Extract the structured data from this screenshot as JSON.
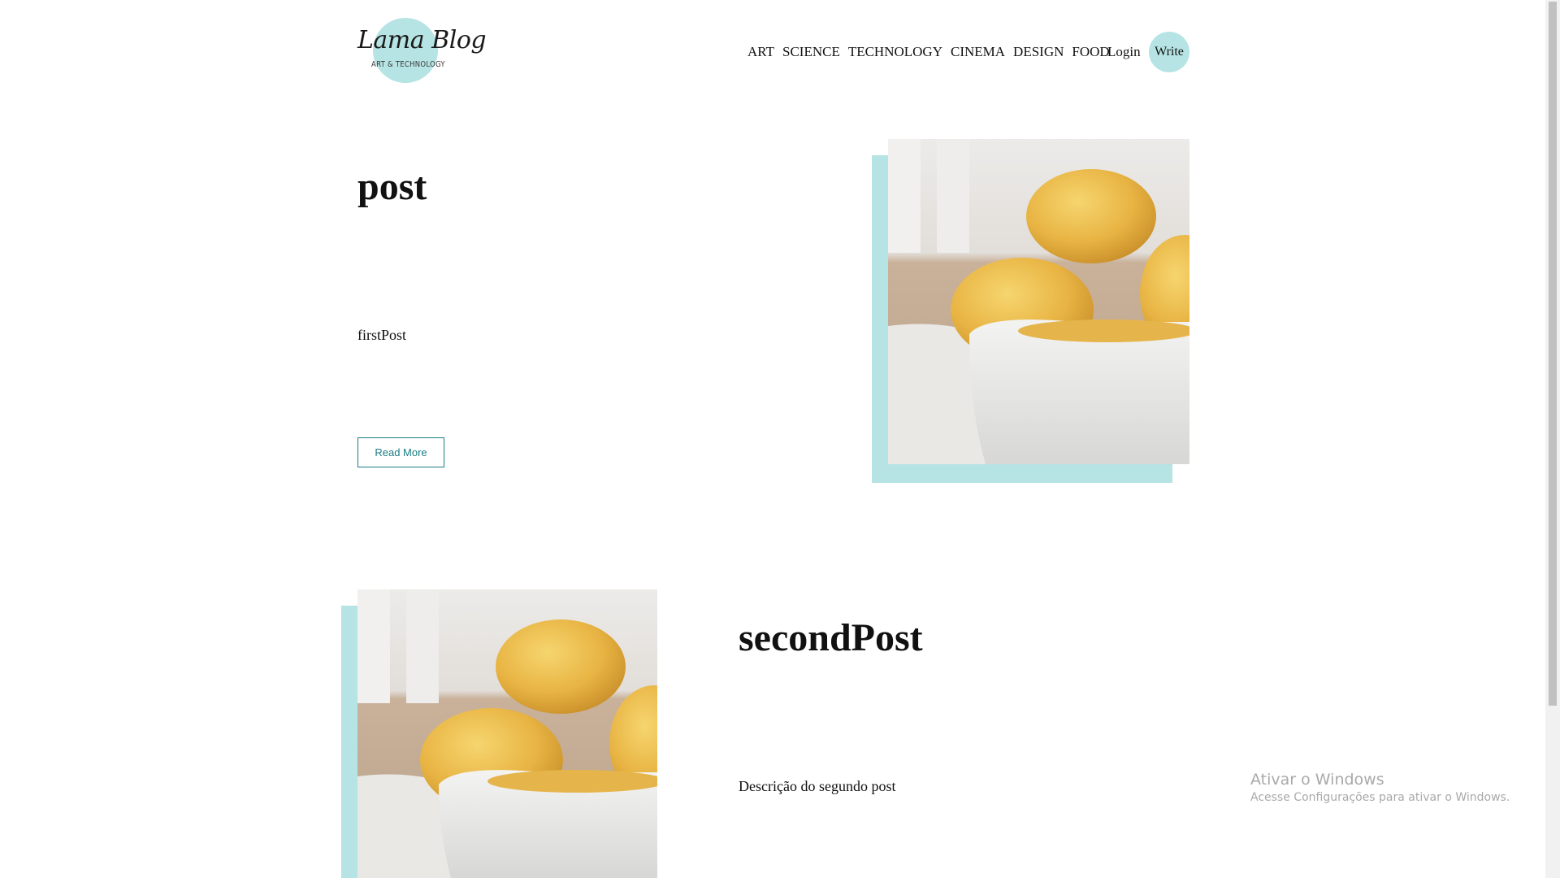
{
  "logo": {
    "title": "Lama Blog",
    "subtitle": "ART & TECHNOLOGY",
    "accent_color": "#b6e3e3"
  },
  "nav": {
    "items": [
      "ART",
      "SCIENCE",
      "TECHNOLOGY",
      "CINEMA",
      "DESIGN",
      "FOOD"
    ],
    "login": "Login",
    "write": "Write"
  },
  "posts": [
    {
      "title": "post",
      "desc": "firstPost",
      "button": "Read More",
      "image": "lemons-in-white-bowl-photo"
    },
    {
      "title": "secondPost",
      "desc": "Descrição do segundo post",
      "image": "lemons-in-white-bowl-photo"
    }
  ],
  "watermark": {
    "title": "Ativar o Windows",
    "subtitle": "Acesse Configurações para ativar o Windows."
  },
  "colors": {
    "accent": "#b6e3e3",
    "button": "#1b7d84"
  }
}
